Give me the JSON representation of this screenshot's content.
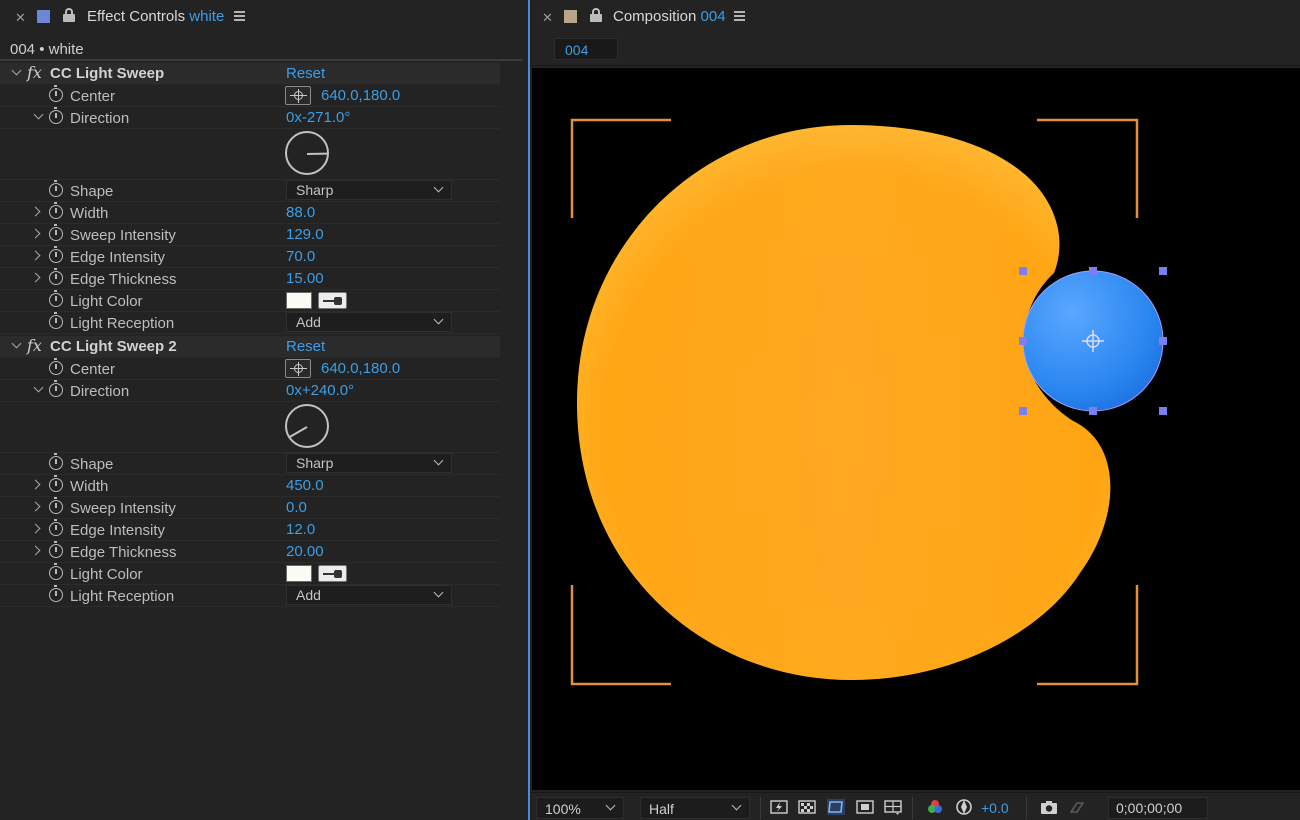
{
  "effect_controls": {
    "tab_title": "Effect Controls",
    "tab_layer": "white",
    "layer_label": "004 • white",
    "effects": [
      {
        "name": "CC Light Sweep",
        "reset": "Reset",
        "center_label": "Center",
        "center_value": "640.0,180.0",
        "direction_label": "Direction",
        "direction_prefix": "0x",
        "direction_value": "-271.0°",
        "direction_degrees": -271,
        "shape_label": "Shape",
        "shape_value": "Sharp",
        "width_label": "Width",
        "width_value": "88.0",
        "sweep_intensity_label": "Sweep Intensity",
        "sweep_intensity_value": "129.0",
        "edge_intensity_label": "Edge Intensity",
        "edge_intensity_value": "70.0",
        "edge_thickness_label": "Edge Thickness",
        "edge_thickness_value": "15.00",
        "light_color_label": "Light Color",
        "light_color": "#fbfbf5",
        "light_reception_label": "Light Reception",
        "light_reception_value": "Add"
      },
      {
        "name": "CC Light Sweep 2",
        "reset": "Reset",
        "center_label": "Center",
        "center_value": "640.0,180.0",
        "direction_label": "Direction",
        "direction_prefix": "0x",
        "direction_value": "+240.0°",
        "direction_degrees": 240,
        "shape_label": "Shape",
        "shape_value": "Sharp",
        "width_label": "Width",
        "width_value": "450.0",
        "sweep_intensity_label": "Sweep Intensity",
        "sweep_intensity_value": "0.0",
        "edge_intensity_label": "Edge Intensity",
        "edge_intensity_value": "12.0",
        "edge_thickness_label": "Edge Thickness",
        "edge_thickness_value": "20.00",
        "light_color_label": "Light Color",
        "light_color": "#fbfbf5",
        "light_reception_label": "Light Reception",
        "light_reception_value": "Add"
      }
    ]
  },
  "composition": {
    "tab_title": "Composition",
    "tab_comp": "004",
    "comp_chip": "004",
    "shape_color": "#ffa311",
    "selected_layer_color": "#2a86f0",
    "bounding_color": "#e0913a"
  },
  "viewer_controls": {
    "zoom": "100%",
    "resolution": "Half",
    "exposure": "+0.0",
    "timecode": "0;00;00;00"
  },
  "colors": {
    "accent_blue": "#3d9ee6",
    "panel_bg": "#232323",
    "swatch_effect_controls": "#6f86d6",
    "swatch_composition": "#b8a58a"
  }
}
